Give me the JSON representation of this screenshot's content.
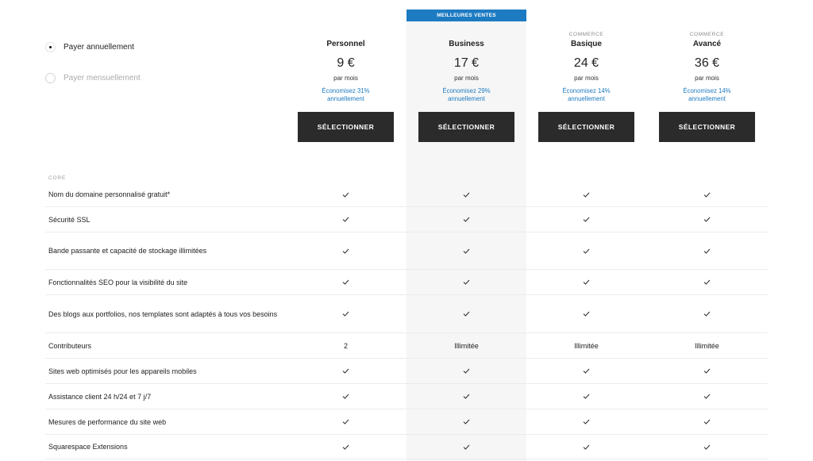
{
  "banner": "MEILLEURES VENTES",
  "billing": {
    "annual": "Payer annuellement",
    "monthly": "Payer mensuellement"
  },
  "plans": [
    {
      "tag": "",
      "name": "Personnel",
      "price": "9 €",
      "period": "par mois",
      "save": "Économisez 31% annuellement",
      "cta": "SÉLECTIONNER"
    },
    {
      "tag": "",
      "name": "Business",
      "price": "17 €",
      "period": "par mois",
      "save": "Économisez 29% annuellement",
      "cta": "SÉLECTIONNER"
    },
    {
      "tag": "COMMERCE",
      "name": "Basique",
      "price": "24 €",
      "period": "par mois",
      "save": "Économisez 14% annuellement",
      "cta": "SÉLECTIONNER"
    },
    {
      "tag": "COMMERCE",
      "name": "Avancé",
      "price": "36 €",
      "period": "par mois",
      "save": "Économisez 14% annuellement",
      "cta": "SÉLECTIONNER"
    }
  ],
  "section": "CORE",
  "features": [
    {
      "label": "Nom du domaine personnalisé gratuit*",
      "values": [
        "check",
        "check",
        "check",
        "check"
      ]
    },
    {
      "label": "Sécurité SSL",
      "values": [
        "check",
        "check",
        "check",
        "check"
      ]
    },
    {
      "label": "Bande passante et capacité de stockage illimitées",
      "values": [
        "check",
        "check",
        "check",
        "check"
      ]
    },
    {
      "label": "Fonctionnalités SEO pour la visibilité du site",
      "values": [
        "check",
        "check",
        "check",
        "check"
      ]
    },
    {
      "label": "Des blogs aux portfolios, nos templates sont adaptés à tous vos besoins",
      "values": [
        "check",
        "check",
        "check",
        "check"
      ]
    },
    {
      "label": "Contributeurs",
      "values": [
        "2",
        "Illimitée",
        "Illimitée",
        "Illimitée"
      ]
    },
    {
      "label": "Sites web optimisés pour les appareils mobiles",
      "values": [
        "check",
        "check",
        "check",
        "check"
      ]
    },
    {
      "label": "Assistance client 24 h/24 et 7 j/7",
      "values": [
        "check",
        "check",
        "check",
        "check"
      ]
    },
    {
      "label": "Mesures de performance du site web",
      "values": [
        "check",
        "check",
        "check",
        "check"
      ]
    },
    {
      "label": "Squarespace Extensions",
      "values": [
        "check",
        "check",
        "check",
        "check"
      ]
    }
  ],
  "colors": {
    "accent": "#1d7bc2",
    "button": "#2b2b2b",
    "highlight": "#f6f6f6"
  }
}
